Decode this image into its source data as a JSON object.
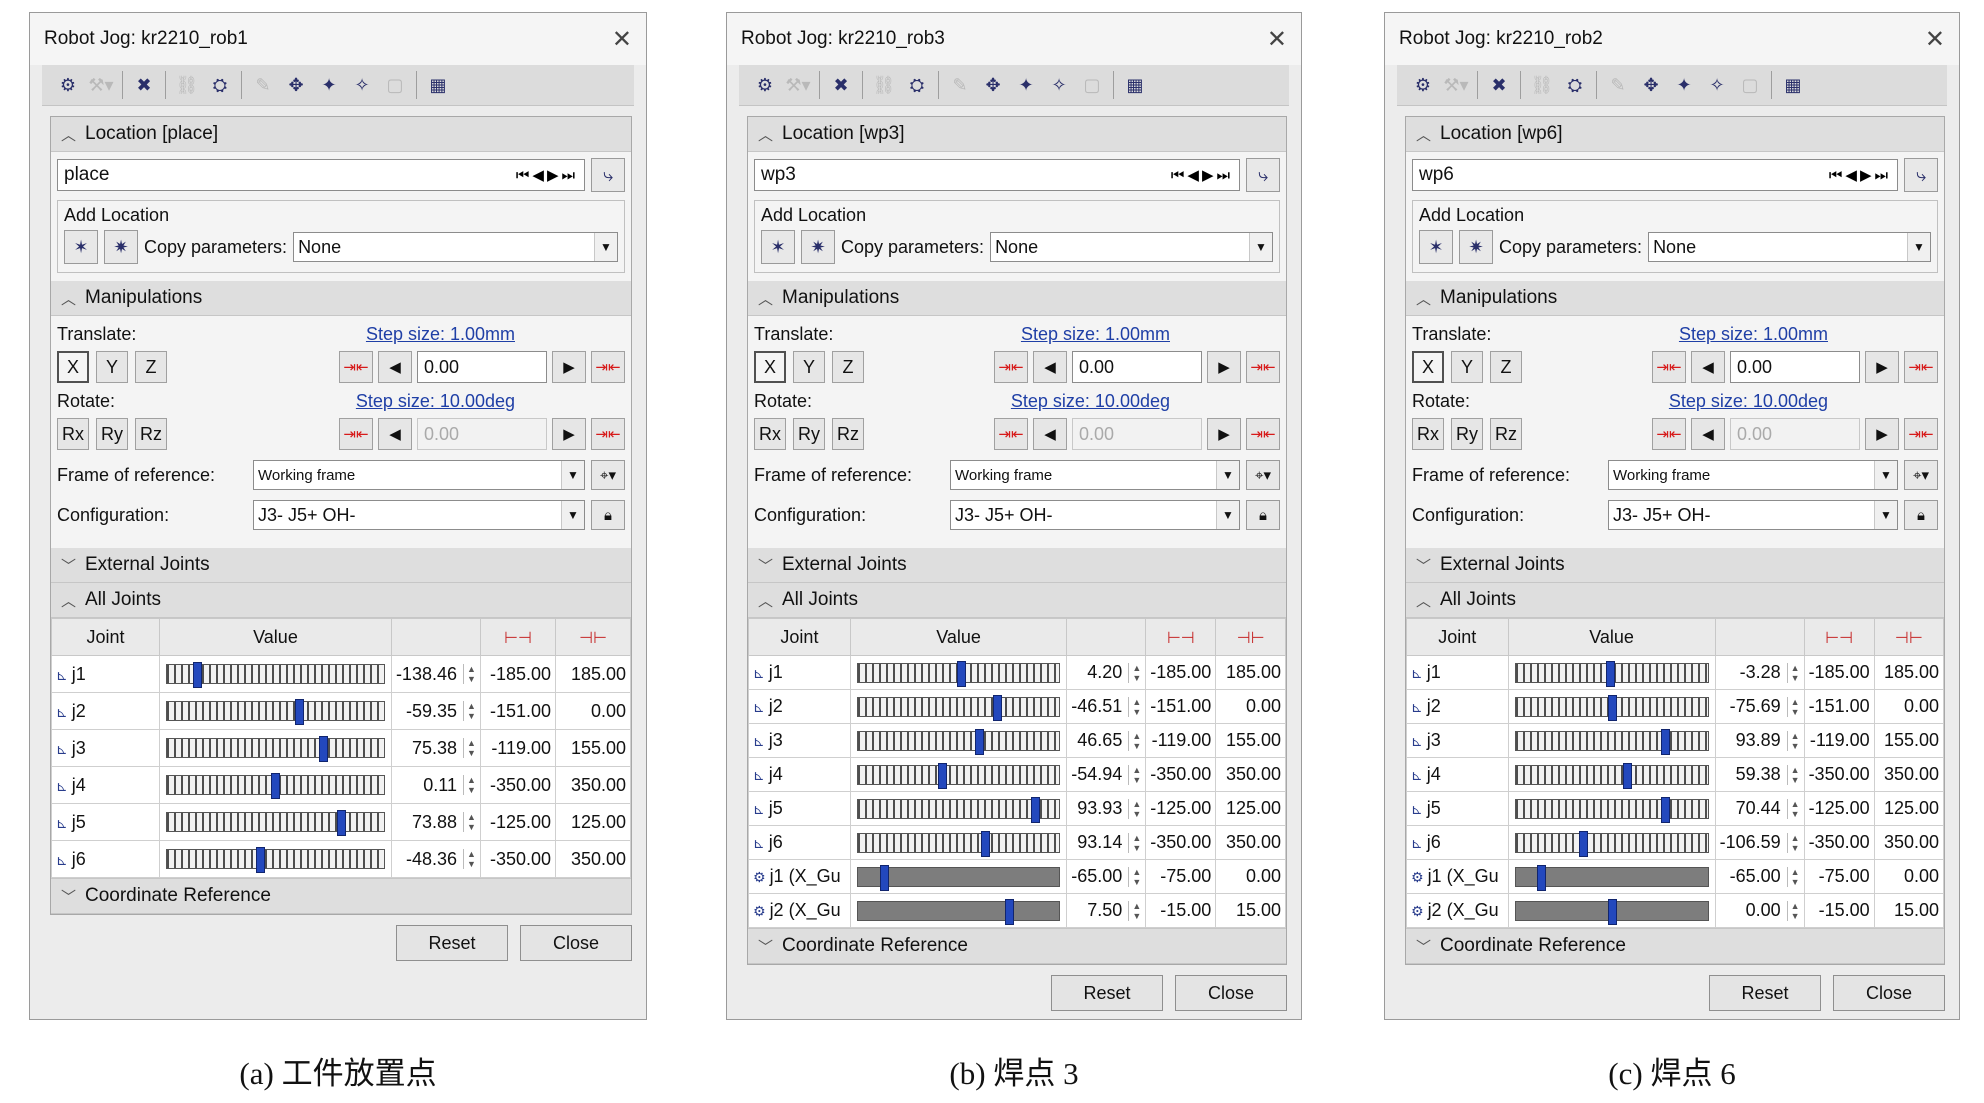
{
  "panels": [
    {
      "title": "Robot Jog: kr2210_rob1",
      "location": {
        "header": "Location [place]",
        "value": "place"
      },
      "add_location": {
        "label": "Add Location",
        "copy_label": "Copy parameters:",
        "copy_value": "None"
      },
      "manipulations": {
        "header": "Manipulations",
        "translate_label": "Translate:",
        "translate_step": "Step size: 1.00mm",
        "translate_value": "0.00",
        "rotate_label": "Rotate:",
        "rotate_step": "Step size: 10.00deg",
        "rotate_value": "0.00",
        "translate_buttons": [
          "X",
          "Y",
          "Z"
        ],
        "rotate_buttons": [
          "Rx",
          "Ry",
          "Rz"
        ],
        "frame_label": "Frame of reference:",
        "frame_value": "Working frame",
        "config_label": "Configuration:",
        "config_value": "J3- J5+ OH-"
      },
      "external_joints": "External Joints",
      "all_joints": "All Joints",
      "headers": {
        "joint": "Joint",
        "value": "Value"
      },
      "joints": [
        {
          "name": "j1",
          "value": "-138.46",
          "min": "-185.00",
          "max": "185.00",
          "pos": 0.14
        },
        {
          "name": "j2",
          "value": "-59.35",
          "min": "-151.00",
          "max": "0.00",
          "pos": 0.61
        },
        {
          "name": "j3",
          "value": "75.38",
          "min": "-119.00",
          "max": "155.00",
          "pos": 0.72
        },
        {
          "name": "j4",
          "value": "0.11",
          "min": "-350.00",
          "max": "350.00",
          "pos": 0.5
        },
        {
          "name": "j5",
          "value": "73.88",
          "min": "-125.00",
          "max": "125.00",
          "pos": 0.8
        },
        {
          "name": "j6",
          "value": "-48.36",
          "min": "-350.00",
          "max": "350.00",
          "pos": 0.43
        }
      ],
      "coord_ref": "Coordinate Reference",
      "reset": "Reset",
      "close": "Close"
    },
    {
      "title": "Robot Jog: kr2210_rob3",
      "location": {
        "header": "Location [wp3]",
        "value": "wp3"
      },
      "add_location": {
        "label": "Add Location",
        "copy_label": "Copy parameters:",
        "copy_value": "None"
      },
      "manipulations": {
        "header": "Manipulations",
        "translate_label": "Translate:",
        "translate_step": "Step size: 1.00mm",
        "translate_value": "0.00",
        "rotate_label": "Rotate:",
        "rotate_step": "Step size: 10.00deg",
        "rotate_value": "0.00",
        "translate_buttons": [
          "X",
          "Y",
          "Z"
        ],
        "rotate_buttons": [
          "Rx",
          "Ry",
          "Rz"
        ],
        "frame_label": "Frame of reference:",
        "frame_value": "Working frame",
        "config_label": "Configuration:",
        "config_value": "J3- J5+ OH-"
      },
      "external_joints": "External Joints",
      "all_joints": "All Joints",
      "headers": {
        "joint": "Joint",
        "value": "Value"
      },
      "joints": [
        {
          "name": "j1",
          "value": "4.20",
          "min": "-185.00",
          "max": "185.00",
          "pos": 0.51
        },
        {
          "name": "j2",
          "value": "-46.51",
          "min": "-151.00",
          "max": "0.00",
          "pos": 0.69
        },
        {
          "name": "j3",
          "value": "46.65",
          "min": "-119.00",
          "max": "155.00",
          "pos": 0.6
        },
        {
          "name": "j4",
          "value": "-54.94",
          "min": "-350.00",
          "max": "350.00",
          "pos": 0.42
        },
        {
          "name": "j5",
          "value": "93.93",
          "min": "-125.00",
          "max": "125.00",
          "pos": 0.88
        },
        {
          "name": "j6",
          "value": "93.14",
          "min": "-350.00",
          "max": "350.00",
          "pos": 0.63
        },
        {
          "name": "j1 (X_Gu",
          "value": "-65.00",
          "min": "-75.00",
          "max": "0.00",
          "pos": 0.13,
          "external": true
        },
        {
          "name": "j2 (X_Gu",
          "value": "7.50",
          "min": "-15.00",
          "max": "15.00",
          "pos": 0.75,
          "external": true
        }
      ],
      "coord_ref": "Coordinate Reference",
      "reset": "Reset",
      "close": "Close"
    },
    {
      "title": "Robot Jog: kr2210_rob2",
      "location": {
        "header": "Location [wp6]",
        "value": "wp6"
      },
      "add_location": {
        "label": "Add Location",
        "copy_label": "Copy parameters:",
        "copy_value": "None"
      },
      "manipulations": {
        "header": "Manipulations",
        "translate_label": "Translate:",
        "translate_step": "Step size: 1.00mm",
        "translate_value": "0.00",
        "rotate_label": "Rotate:",
        "rotate_step": "Step size: 10.00deg",
        "rotate_value": "0.00",
        "translate_buttons": [
          "X",
          "Y",
          "Z"
        ],
        "rotate_buttons": [
          "Rx",
          "Ry",
          "Rz"
        ],
        "frame_label": "Frame of reference:",
        "frame_value": "Working frame",
        "config_label": "Configuration:",
        "config_value": "J3- J5+ OH-"
      },
      "external_joints": "External Joints",
      "all_joints": "All Joints",
      "headers": {
        "joint": "Joint",
        "value": "Value"
      },
      "joints": [
        {
          "name": "j1",
          "value": "-3.28",
          "min": "-185.00",
          "max": "185.00",
          "pos": 0.49
        },
        {
          "name": "j2",
          "value": "-75.69",
          "min": "-151.00",
          "max": "0.00",
          "pos": 0.5
        },
        {
          "name": "j3",
          "value": "93.89",
          "min": "-119.00",
          "max": "155.00",
          "pos": 0.78
        },
        {
          "name": "j4",
          "value": "59.38",
          "min": "-350.00",
          "max": "350.00",
          "pos": 0.58
        },
        {
          "name": "j5",
          "value": "70.44",
          "min": "-125.00",
          "max": "125.00",
          "pos": 0.78
        },
        {
          "name": "j6",
          "value": "-106.59",
          "min": "-350.00",
          "max": "350.00",
          "pos": 0.35
        },
        {
          "name": "j1 (X_Gu",
          "value": "-65.00",
          "min": "-75.00",
          "max": "0.00",
          "pos": 0.13,
          "external": true
        },
        {
          "name": "j2 (X_Gu",
          "value": "0.00",
          "min": "-15.00",
          "max": "15.00",
          "pos": 0.5,
          "external": true
        }
      ],
      "coord_ref": "Coordinate Reference",
      "reset": "Reset",
      "close": "Close"
    }
  ],
  "captions": [
    "(a) 工件放置点",
    "(b) 焊点 3",
    "(c) 焊点 6"
  ],
  "colors": {
    "link": "#1f3fa6",
    "thumb": "#2348bd",
    "limit": "#d71a1a"
  }
}
